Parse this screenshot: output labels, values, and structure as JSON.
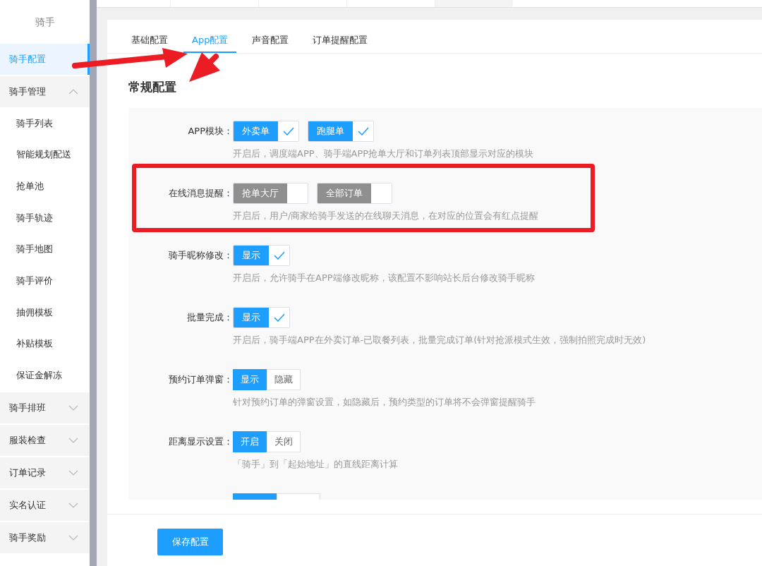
{
  "sidebar": {
    "title": "骑手",
    "items": [
      {
        "label": "骑手配置",
        "selected": true
      }
    ],
    "groups": [
      {
        "label": "骑手管理",
        "expanded": true,
        "children": [
          {
            "label": "骑手列表"
          },
          {
            "label": "智能规划配送"
          },
          {
            "label": "抢单池"
          },
          {
            "label": "骑手轨迹"
          },
          {
            "label": "骑手地图"
          },
          {
            "label": "骑手评价"
          },
          {
            "label": "抽佣模板"
          },
          {
            "label": "补贴模板"
          },
          {
            "label": "保证金解冻"
          }
        ]
      },
      {
        "label": "骑手排班",
        "expanded": false
      },
      {
        "label": "服装检查",
        "expanded": false
      },
      {
        "label": "订单记录",
        "expanded": false
      },
      {
        "label": "实名认证",
        "expanded": false
      },
      {
        "label": "骑手奖励",
        "expanded": false
      }
    ]
  },
  "tabs": [
    {
      "label": "基础配置",
      "selected": false
    },
    {
      "label": "App配置",
      "selected": true
    },
    {
      "label": "声音配置",
      "selected": false
    },
    {
      "label": "订单提醒配置",
      "selected": false
    }
  ],
  "section_title": "常规配置",
  "rows": [
    {
      "kind": "check",
      "label": "APP模块：",
      "options": [
        {
          "label": "外卖单",
          "checked": true
        },
        {
          "label": "跑腿单",
          "checked": true
        }
      ],
      "hint": "开启后，调度端APP、骑手端APP抢单大厅和订单列表顶部显示对应的模块",
      "highlighted": false
    },
    {
      "kind": "check",
      "label": "在线消息提醒：",
      "options": [
        {
          "label": "抢单大厅",
          "checked": false
        },
        {
          "label": "全部订单",
          "checked": false
        }
      ],
      "hint": "开启后，用户/商家给骑手发送的在线聊天消息，在对应的位置会有红点提醒",
      "highlighted": true
    },
    {
      "kind": "check",
      "label": "骑手昵称修改：",
      "options": [
        {
          "label": "显示",
          "checked": true
        }
      ],
      "hint": "开启后，允许骑手在APP端修改昵称，该配置不影响站长后台修改骑手昵称",
      "highlighted": false
    },
    {
      "kind": "check",
      "label": "批量完成：",
      "options": [
        {
          "label": "显示",
          "checked": true
        }
      ],
      "hint": "开启后，骑手端APP在外卖订单-已取餐列表，批量完成订单(针对抢派模式生效，强制拍照完成时无效)",
      "highlighted": false
    },
    {
      "kind": "toggle",
      "label": "预约订单弹窗：",
      "options": [
        {
          "label": "显示",
          "selected": true
        },
        {
          "label": "隐藏",
          "selected": false
        }
      ],
      "hint": "针对预约订单的弹窗设置，如隐藏后，预约类型的订单将不会弹窗提醒骑手",
      "highlighted": false
    },
    {
      "kind": "toggle",
      "label": "距离显示设置：",
      "options": [
        {
          "label": "开启",
          "selected": true
        },
        {
          "label": "关闭",
          "selected": false
        }
      ],
      "hint": "「骑手」到「起始地址」的直线距离计算",
      "highlighted": false
    },
    {
      "kind": "partial",
      "options": [
        {
          "selected": true
        },
        {
          "selected": false
        }
      ]
    }
  ],
  "save_button": "保存配置"
}
